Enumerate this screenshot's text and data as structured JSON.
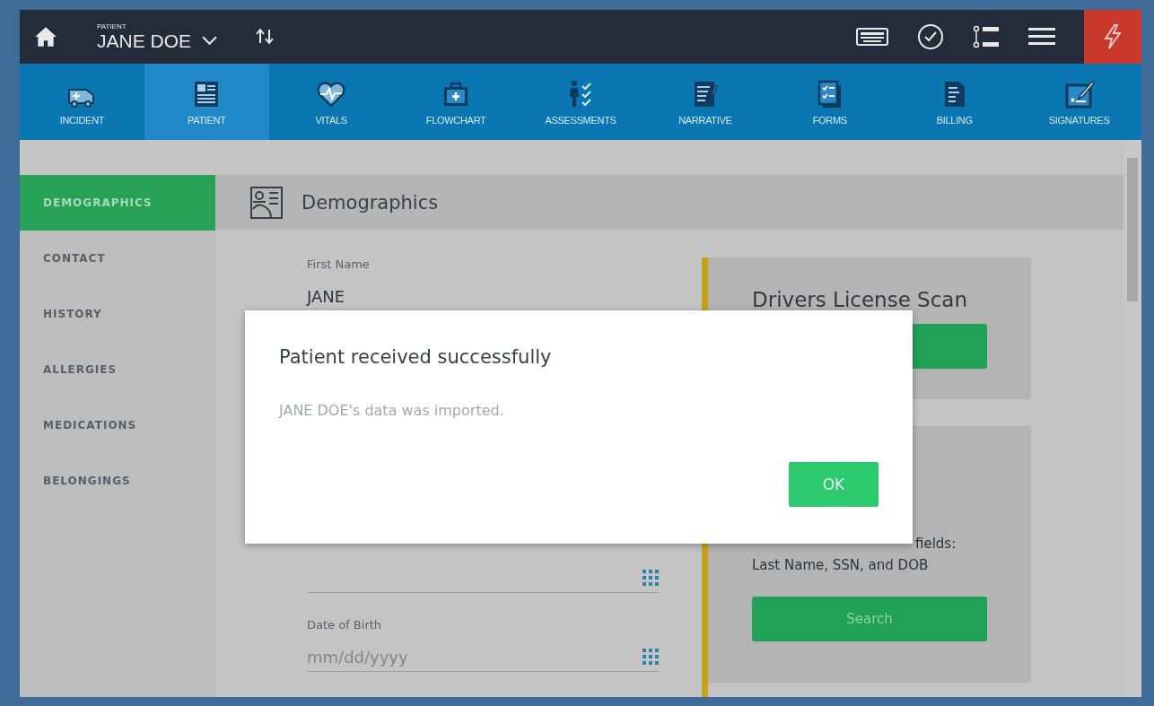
{
  "header": {
    "label": "PATIENT",
    "name": "JANE DOE"
  },
  "nav_tabs": [
    {
      "label": "INCIDENT",
      "selected": false
    },
    {
      "label": "PATIENT",
      "selected": true
    },
    {
      "label": "VITALS",
      "selected": false
    },
    {
      "label": "FLOWCHART",
      "selected": false
    },
    {
      "label": "ASSESSMENTS",
      "selected": false
    },
    {
      "label": "NARRATIVE",
      "selected": false
    },
    {
      "label": "FORMS",
      "selected": false
    },
    {
      "label": "BILLING",
      "selected": false
    },
    {
      "label": "SIGNATURES",
      "selected": false
    }
  ],
  "sidebar": {
    "items": [
      {
        "label": "DEMOGRAPHICS",
        "selected": true
      },
      {
        "label": "CONTACT",
        "selected": false
      },
      {
        "label": "HISTORY",
        "selected": false
      },
      {
        "label": "ALLERGIES",
        "selected": false
      },
      {
        "label": "MEDICATIONS",
        "selected": false
      },
      {
        "label": "BELONGINGS",
        "selected": false
      }
    ]
  },
  "section": {
    "title": "Demographics"
  },
  "fields": [
    {
      "label": "First Name",
      "value": "JANE",
      "keypad": false
    },
    {
      "keypad": true
    },
    {
      "label": "Date of Birth",
      "placeholder": "mm/dd/yyyy",
      "keypad": true
    }
  ],
  "license_card": {
    "title": "Drivers License Scan"
  },
  "search_card": {
    "text_lines": [
      "fields:",
      "Last Name, SSN, and DOB"
    ],
    "button": "Search"
  },
  "dialog": {
    "title": "Patient received successfully",
    "message": "JANE DOE's data was imported.",
    "button": "OK"
  }
}
